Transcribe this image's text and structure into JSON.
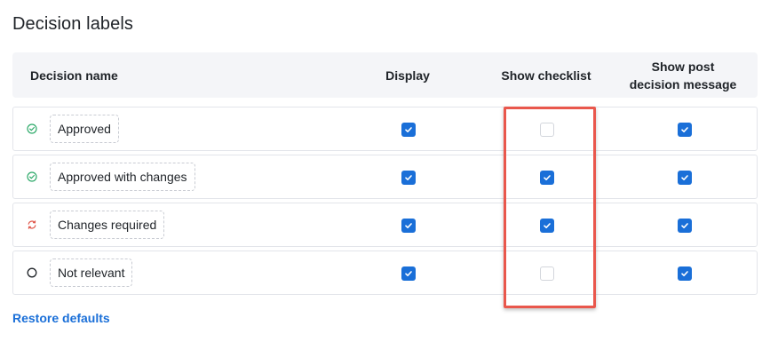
{
  "section": {
    "title": "Decision labels"
  },
  "table": {
    "headers": {
      "name": "Decision name",
      "display": "Display",
      "checklist": "Show checklist",
      "post_message": "Show post decision message"
    },
    "rows": [
      {
        "name": "Approved",
        "icon": "check-circle-icon",
        "icon_color": "#2eaa6a",
        "display": true,
        "checklist": false,
        "post_message": true
      },
      {
        "name": "Approved with changes",
        "icon": "check-circle-icon",
        "icon_color": "#2eaa6a",
        "display": true,
        "checklist": true,
        "post_message": true
      },
      {
        "name": "Changes required",
        "icon": "refresh-icon",
        "icon_color": "#e05a4e",
        "display": true,
        "checklist": true,
        "post_message": true
      },
      {
        "name": "Not relevant",
        "icon": "circle-icon",
        "icon_color": "#1f2328",
        "display": true,
        "checklist": false,
        "post_message": true
      }
    ]
  },
  "actions": {
    "restore_label": "Restore defaults"
  },
  "colors": {
    "accent": "#1a6fd8",
    "highlight": "#e9574c"
  }
}
